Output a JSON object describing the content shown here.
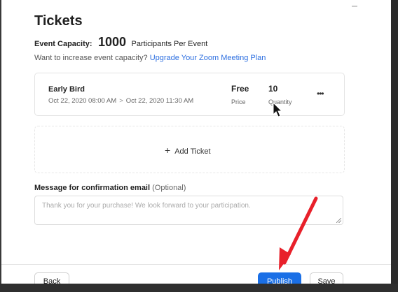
{
  "section_title": "Tickets",
  "capacity": {
    "label": "Event Capacity:",
    "number": "1000",
    "suffix": "Participants Per Event"
  },
  "increase": {
    "text": "Want to increase event capacity?",
    "link": "Upgrade Your Zoom Meeting Plan"
  },
  "ticket": {
    "name": "Early Bird",
    "start": "Oct 22, 2020 08:00 AM",
    "separator": ">",
    "end": "Oct 22, 2020 11:30 AM",
    "price": "Free",
    "price_label": "Price",
    "quantity": "10",
    "quantity_label": "Quantity",
    "more": "•••"
  },
  "add_ticket": {
    "icon": "+",
    "label": "Add Ticket"
  },
  "message": {
    "label": "Message for confirmation email",
    "optional": "(Optional)",
    "placeholder": "Thank you for your purchase! We look forward to your participation."
  },
  "footer": {
    "back": "Back",
    "publish": "Publish",
    "save": "Save"
  },
  "colors": {
    "accent": "#1a6fe6",
    "link": "#2d6fe0",
    "annotation_arrow": "#e8202a"
  },
  "icons": {
    "more": "more-horizontal-icon",
    "add": "plus-icon",
    "cursor": "mouse-pointer-icon",
    "arrow": "red-annotation-arrow"
  }
}
